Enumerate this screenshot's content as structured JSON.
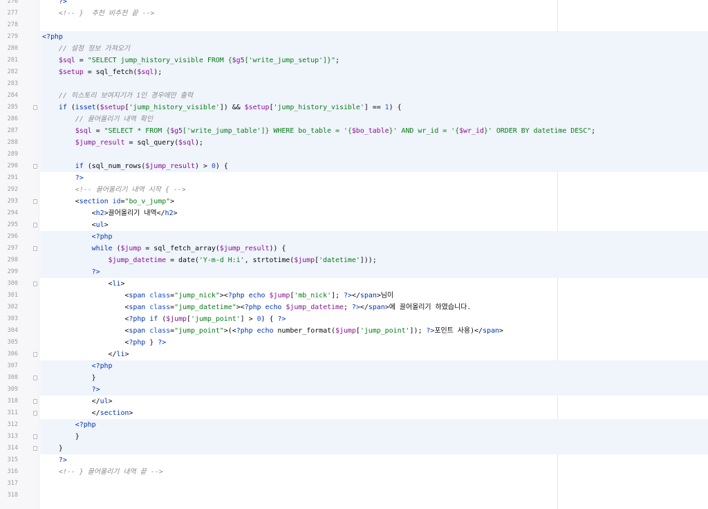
{
  "editor": {
    "lines": [
      {
        "num": "276",
        "tokens": [
          [
            "m",
            "    ?>"
          ]
        ],
        "hl": false,
        "fold": false
      },
      {
        "num": "277",
        "tokens": [
          [
            "c",
            "    <!-- }  추천 비추천 끝 -->"
          ]
        ],
        "hl": false,
        "fold": false
      },
      {
        "num": "278",
        "tokens": [],
        "hl": false,
        "fold": false
      },
      {
        "num": "279",
        "tokens": [
          [
            "m",
            "<?php"
          ]
        ],
        "hl": true,
        "fold": false
      },
      {
        "num": "280",
        "tokens": [
          [
            "c",
            "    // 설정 정보 가져오기"
          ]
        ],
        "hl": true,
        "fold": false
      },
      {
        "num": "281",
        "tokens": [
          [
            "p",
            "    "
          ],
          [
            "v",
            "$sql"
          ],
          [
            "p",
            " = "
          ],
          [
            "s",
            "\"SELECT jump_history_visible FROM {"
          ],
          [
            "v",
            "$g5"
          ],
          [
            "s",
            "['write_jump_setup']}\""
          ],
          [
            "p",
            ";"
          ]
        ],
        "hl": true,
        "fold": false
      },
      {
        "num": "282",
        "tokens": [
          [
            "p",
            "    "
          ],
          [
            "v",
            "$setup"
          ],
          [
            "p",
            " = sql_fetch("
          ],
          [
            "v",
            "$sql"
          ],
          [
            "p",
            ");"
          ]
        ],
        "hl": true,
        "fold": false
      },
      {
        "num": "283",
        "tokens": [],
        "hl": true,
        "fold": false
      },
      {
        "num": "284",
        "tokens": [
          [
            "c",
            "    // 히스토리 보여지기가 1인 경우에만 출력"
          ]
        ],
        "hl": true,
        "fold": false
      },
      {
        "num": "285",
        "tokens": [
          [
            "p",
            "    "
          ],
          [
            "k",
            "if"
          ],
          [
            "p",
            " ("
          ],
          [
            "k",
            "isset"
          ],
          [
            "p",
            "("
          ],
          [
            "v",
            "$setup"
          ],
          [
            "p",
            "["
          ],
          [
            "s",
            "'jump_history_visible'"
          ],
          [
            "p",
            "]) && "
          ],
          [
            "v",
            "$setup"
          ],
          [
            "p",
            "["
          ],
          [
            "s",
            "'jump_history_visible'"
          ],
          [
            "p",
            "] == "
          ],
          [
            "n",
            "1"
          ],
          [
            "p",
            ") {"
          ]
        ],
        "hl": true,
        "fold": true
      },
      {
        "num": "286",
        "tokens": [
          [
            "c",
            "        // 끌어올리기 내역 확인"
          ]
        ],
        "hl": true,
        "fold": false
      },
      {
        "num": "287",
        "tokens": [
          [
            "p",
            "        "
          ],
          [
            "v",
            "$sql"
          ],
          [
            "p",
            " = "
          ],
          [
            "s",
            "\"SELECT * FROM {"
          ],
          [
            "v",
            "$g5"
          ],
          [
            "s",
            "['write_jump_table']} WHERE bo_table = '{"
          ],
          [
            "v",
            "$bo_table"
          ],
          [
            "s",
            "}' AND wr_id = '{"
          ],
          [
            "v",
            "$wr_id"
          ],
          [
            "s",
            "}' ORDER BY datetime DESC\""
          ],
          [
            "p",
            ";"
          ]
        ],
        "hl": true,
        "fold": false
      },
      {
        "num": "288",
        "tokens": [
          [
            "p",
            "        "
          ],
          [
            "v",
            "$jump_result"
          ],
          [
            "p",
            " = sql_query("
          ],
          [
            "v",
            "$sql"
          ],
          [
            "p",
            ");"
          ]
        ],
        "hl": true,
        "fold": false
      },
      {
        "num": "289",
        "tokens": [],
        "hl": true,
        "fold": false
      },
      {
        "num": "290",
        "tokens": [
          [
            "p",
            "        "
          ],
          [
            "k",
            "if"
          ],
          [
            "p",
            " (sql_num_rows("
          ],
          [
            "v",
            "$jump_result"
          ],
          [
            "p",
            ") > "
          ],
          [
            "n",
            "0"
          ],
          [
            "p",
            ") {"
          ]
        ],
        "hl": true,
        "fold": true
      },
      {
        "num": "291",
        "tokens": [
          [
            "m",
            "        ?>"
          ]
        ],
        "hl": false,
        "fold": false
      },
      {
        "num": "292",
        "tokens": [
          [
            "c",
            "        <!-- 끌어올리기 내역 시작 { -->"
          ]
        ],
        "hl": false,
        "fold": false
      },
      {
        "num": "293",
        "tokens": [
          [
            "p",
            "        <"
          ],
          [
            "t",
            "section"
          ],
          [
            "p",
            " "
          ],
          [
            "a",
            "id"
          ],
          [
            "p",
            "="
          ],
          [
            "s",
            "\"bo_v_jump\""
          ],
          [
            "p",
            ">"
          ]
        ],
        "hl": false,
        "fold": true
      },
      {
        "num": "294",
        "tokens": [
          [
            "p",
            "            <"
          ],
          [
            "t",
            "h2"
          ],
          [
            "p",
            ">끌어올리기 내역</"
          ],
          [
            "t",
            "h2"
          ],
          [
            "p",
            ">"
          ]
        ],
        "hl": false,
        "fold": false
      },
      {
        "num": "295",
        "tokens": [
          [
            "p",
            "            <"
          ],
          [
            "t",
            "ul"
          ],
          [
            "p",
            ">"
          ]
        ],
        "hl": false,
        "fold": true
      },
      {
        "num": "296",
        "tokens": [
          [
            "m",
            "            <?php"
          ]
        ],
        "hl": true,
        "fold": false
      },
      {
        "num": "297",
        "tokens": [
          [
            "p",
            "            "
          ],
          [
            "k",
            "while"
          ],
          [
            "p",
            " ("
          ],
          [
            "v",
            "$jump"
          ],
          [
            "p",
            " = sql_fetch_array("
          ],
          [
            "v",
            "$jump_result"
          ],
          [
            "p",
            ")) {"
          ]
        ],
        "hl": true,
        "fold": true
      },
      {
        "num": "298",
        "tokens": [
          [
            "p",
            "                "
          ],
          [
            "v",
            "$jump_datetime"
          ],
          [
            "p",
            " = date("
          ],
          [
            "s",
            "'Y-m-d H:i'"
          ],
          [
            "p",
            ", strtotime("
          ],
          [
            "v",
            "$jump"
          ],
          [
            "p",
            "["
          ],
          [
            "s",
            "'datetime'"
          ],
          [
            "p",
            "]));"
          ]
        ],
        "hl": true,
        "fold": false
      },
      {
        "num": "299",
        "tokens": [
          [
            "m",
            "            ?>"
          ]
        ],
        "hl": true,
        "fold": false
      },
      {
        "num": "300",
        "tokens": [
          [
            "p",
            "                <"
          ],
          [
            "t",
            "li"
          ],
          [
            "p",
            ">"
          ]
        ],
        "hl": false,
        "fold": true
      },
      {
        "num": "301",
        "tokens": [
          [
            "p",
            "                    <"
          ],
          [
            "t",
            "span"
          ],
          [
            "p",
            " "
          ],
          [
            "a",
            "class"
          ],
          [
            "p",
            "="
          ],
          [
            "s",
            "\"jump_nick\""
          ],
          [
            "p",
            "><"
          ],
          [
            "m",
            "?php"
          ],
          [
            "p",
            " "
          ],
          [
            "k",
            "echo"
          ],
          [
            "p",
            " "
          ],
          [
            "v",
            "$jump"
          ],
          [
            "p",
            "["
          ],
          [
            "s",
            "'mb_nick'"
          ],
          [
            "p",
            "]; "
          ],
          [
            "m",
            "?>"
          ],
          [
            "p",
            "</"
          ],
          [
            "t",
            "span"
          ],
          [
            "p",
            ">님이"
          ]
        ],
        "hl": false,
        "fold": false
      },
      {
        "num": "302",
        "tokens": [
          [
            "p",
            "                    <"
          ],
          [
            "t",
            "span"
          ],
          [
            "p",
            " "
          ],
          [
            "a",
            "class"
          ],
          [
            "p",
            "="
          ],
          [
            "s",
            "\"jump_datetime\""
          ],
          [
            "p",
            "><"
          ],
          [
            "m",
            "?php"
          ],
          [
            "p",
            " "
          ],
          [
            "k",
            "echo"
          ],
          [
            "p",
            " "
          ],
          [
            "v",
            "$jump_datetime"
          ],
          [
            "p",
            "; "
          ],
          [
            "m",
            "?>"
          ],
          [
            "p",
            "</"
          ],
          [
            "t",
            "span"
          ],
          [
            "p",
            ">에 끌어올리기 하였습니다."
          ]
        ],
        "hl": false,
        "fold": false
      },
      {
        "num": "303",
        "tokens": [
          [
            "p",
            "                    <"
          ],
          [
            "m",
            "?php"
          ],
          [
            "p",
            " "
          ],
          [
            "k",
            "if"
          ],
          [
            "p",
            " ("
          ],
          [
            "v",
            "$jump"
          ],
          [
            "p",
            "["
          ],
          [
            "s",
            "'jump_point'"
          ],
          [
            "p",
            "] > "
          ],
          [
            "n",
            "0"
          ],
          [
            "p",
            ") { "
          ],
          [
            "m",
            "?>"
          ]
        ],
        "hl": false,
        "fold": false
      },
      {
        "num": "304",
        "tokens": [
          [
            "p",
            "                    <"
          ],
          [
            "t",
            "span"
          ],
          [
            "p",
            " "
          ],
          [
            "a",
            "class"
          ],
          [
            "p",
            "="
          ],
          [
            "s",
            "\"jump_point\""
          ],
          [
            "p",
            ">(<"
          ],
          [
            "m",
            "?php"
          ],
          [
            "p",
            " "
          ],
          [
            "k",
            "echo"
          ],
          [
            "p",
            " number_format("
          ],
          [
            "v",
            "$jump"
          ],
          [
            "p",
            "["
          ],
          [
            "s",
            "'jump_point'"
          ],
          [
            "p",
            "]); "
          ],
          [
            "m",
            "?>"
          ],
          [
            "p",
            "포인트 사용)</"
          ],
          [
            "t",
            "span"
          ],
          [
            "p",
            ">"
          ]
        ],
        "hl": false,
        "fold": false
      },
      {
        "num": "305",
        "tokens": [
          [
            "p",
            "                    <"
          ],
          [
            "m",
            "?php"
          ],
          [
            "p",
            " } "
          ],
          [
            "m",
            "?>"
          ]
        ],
        "hl": false,
        "fold": false
      },
      {
        "num": "306",
        "tokens": [
          [
            "p",
            "                </"
          ],
          [
            "t",
            "li"
          ],
          [
            "p",
            ">"
          ]
        ],
        "hl": false,
        "fold": true
      },
      {
        "num": "307",
        "tokens": [
          [
            "m",
            "            <?php"
          ]
        ],
        "hl": true,
        "fold": false
      },
      {
        "num": "308",
        "tokens": [
          [
            "p",
            "            }"
          ]
        ],
        "hl": true,
        "fold": true
      },
      {
        "num": "309",
        "tokens": [
          [
            "m",
            "            ?>"
          ]
        ],
        "hl": true,
        "fold": false
      },
      {
        "num": "310",
        "tokens": [
          [
            "p",
            "            </"
          ],
          [
            "t",
            "ul"
          ],
          [
            "p",
            ">"
          ]
        ],
        "hl": false,
        "fold": true
      },
      {
        "num": "311",
        "tokens": [
          [
            "p",
            "            </"
          ],
          [
            "t",
            "section"
          ],
          [
            "p",
            ">"
          ]
        ],
        "hl": false,
        "fold": true
      },
      {
        "num": "312",
        "tokens": [
          [
            "m",
            "        <?php"
          ]
        ],
        "hl": true,
        "fold": false
      },
      {
        "num": "313",
        "tokens": [
          [
            "p",
            "        }"
          ]
        ],
        "hl": true,
        "fold": true
      },
      {
        "num": "314",
        "tokens": [
          [
            "p",
            "    }"
          ]
        ],
        "hl": true,
        "fold": true
      },
      {
        "num": "315",
        "tokens": [
          [
            "m",
            "    ?>"
          ]
        ],
        "hl": false,
        "fold": false
      },
      {
        "num": "316",
        "tokens": [
          [
            "c",
            "    <!-- } 끌어올리기 내역 끝 -->"
          ]
        ],
        "hl": false,
        "fold": false
      },
      {
        "num": "317",
        "tokens": [],
        "hl": false,
        "fold": false
      },
      {
        "num": "318",
        "tokens": [],
        "hl": false,
        "fold": false
      }
    ]
  }
}
